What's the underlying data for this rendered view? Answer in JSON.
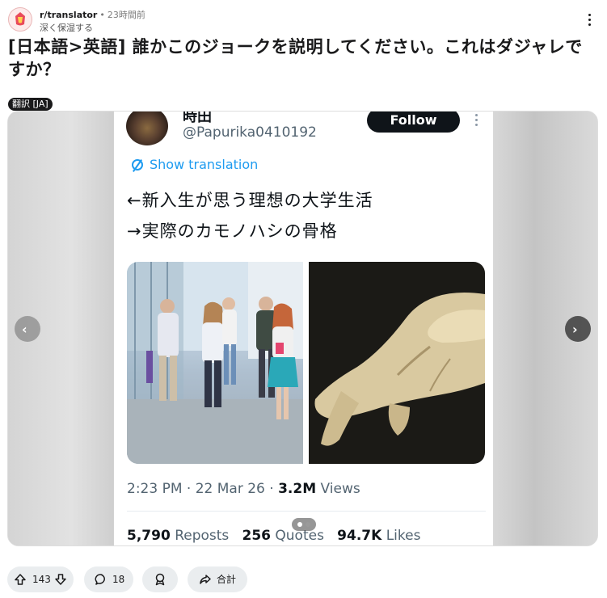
{
  "post": {
    "subreddit": "r/translator",
    "separator": "•",
    "age": "23時間前",
    "username": "深く保湿する",
    "title": "[日本語>英語] 誰かこのジョークを説明してください。これはダジャレですか？",
    "flair": "翻訳 [JA]"
  },
  "tweet": {
    "name": "時田",
    "handle": "@Papurika0410192",
    "follow_label": "Follow",
    "show_translation": "Show translation",
    "lines": [
      "←新入生が思う理想の大学生活",
      "→実際のカモノハシの骨格"
    ],
    "time": "2:23 PM",
    "date": "22 Mar 26",
    "views_count": "3.2M",
    "views_label": "Views",
    "reposts_count": "5,790",
    "reposts_label": "Reposts",
    "quotes_count": "256",
    "quotes_label": "Quotes",
    "likes_count": "94.7K",
    "likes_label": "Likes"
  },
  "gallery": {
    "prev_icon": "chevron-left-icon",
    "next_icon": "chevron-right-icon",
    "page_count": 2,
    "current_page": 1
  },
  "actions": {
    "upvotes": "143",
    "comments": "18",
    "share_label": "合計"
  },
  "colors": {
    "accent_blue": "#1d9bf0",
    "pill_bg": "#eaedef",
    "dark": "#0f1419"
  }
}
